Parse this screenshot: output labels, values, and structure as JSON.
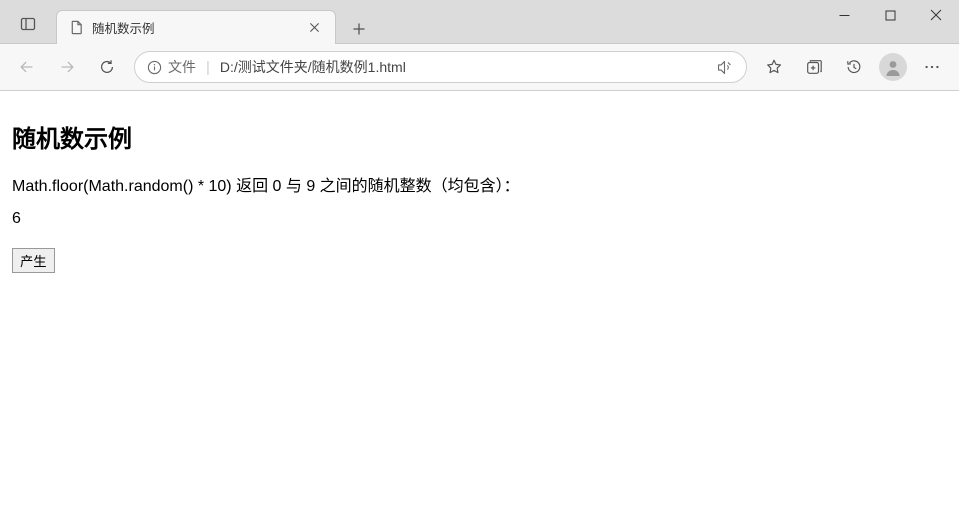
{
  "window": {
    "tab_title": "随机数示例"
  },
  "toolbar": {
    "address_prefix": "文件",
    "url": "D:/测试文件夹/随机数例1.html"
  },
  "page": {
    "heading": "随机数示例",
    "description": "Math.floor(Math.random() * 10) 返回 0 与 9 之间的随机整数（均包含）：",
    "result": "6",
    "button_label": "产生"
  }
}
